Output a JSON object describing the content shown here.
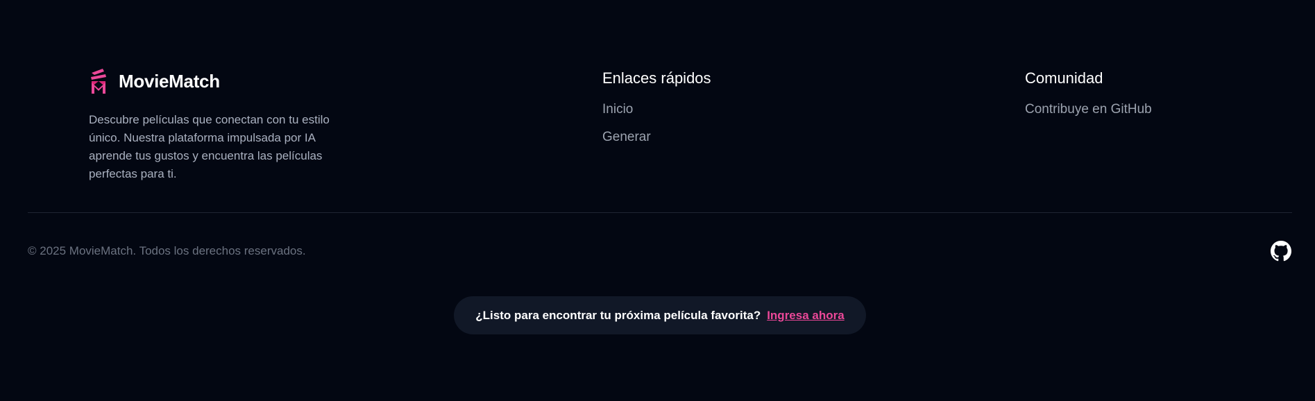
{
  "brand": {
    "name": "MovieMatch",
    "description": "Descubre películas que conectan con tu estilo único. Nuestra plataforma impulsada por IA aprende tus gustos y encuentra las películas perfectas para ti.",
    "logo_icon": "moviematch-logo-icon",
    "accent_color": "#ec4899"
  },
  "quick_links": {
    "title": "Enlaces rápidos",
    "items": [
      {
        "label": "Inicio"
      },
      {
        "label": "Generar"
      }
    ]
  },
  "community": {
    "title": "Comunidad",
    "items": [
      {
        "label": "Contribuye en GitHub"
      }
    ]
  },
  "bottom": {
    "copyright": "© 2025 MovieMatch. Todos los derechos reservados.",
    "social_icon": "github-icon"
  },
  "cta": {
    "text": "¿Listo para encontrar tu próxima película favorita?",
    "link_label": "Ingresa ahora"
  },
  "colors": {
    "background": "#030712",
    "cta_background": "#111827",
    "muted_text": "#9ca3af"
  }
}
